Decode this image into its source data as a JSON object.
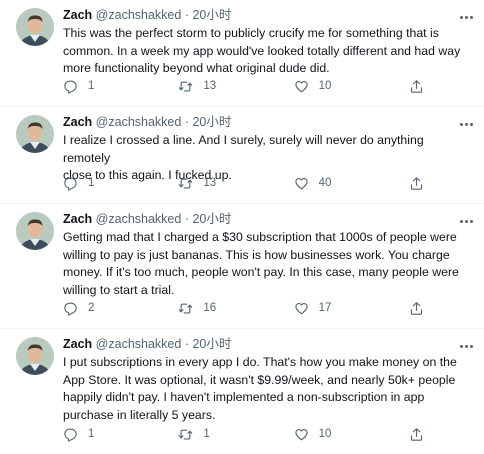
{
  "tweets": [
    {
      "name": "Zach",
      "handle": "@zachshakked",
      "dot": "·",
      "time": "20小时",
      "text": "This was the perfect storm to publicly crucify me for something that is\ncommon. In a week my app would've looked totally different and had way\nmore functionality beyond what original dude did.",
      "replies": "1",
      "retweets": "13",
      "likes": "10"
    },
    {
      "name": "Zach",
      "handle": "@zachshakked",
      "dot": "·",
      "time": "20小时",
      "text": "I realize I crossed a line. And I surely, surely will never do anything remotely\nclose to this again. I fucked up.",
      "replies": "1",
      "retweets": "13",
      "likes": "40"
    },
    {
      "name": "Zach",
      "handle": "@zachshakked",
      "dot": "·",
      "time": "20小时",
      "text": "Getting mad that I charged a $30 subscription that 1000s of people were\nwilling to pay is just bananas. This is how businesses work. You charge\nmoney. If it's too much, people won't pay. In this case, many people were\nwilling to start a trial.",
      "replies": "2",
      "retweets": "16",
      "likes": "17"
    },
    {
      "name": "Zach",
      "handle": "@zachshakked",
      "dot": "·",
      "time": "20小时",
      "text": "I put subscriptions in every app I do. That's how you make money on the\nApp Store. It was optional, it wasn't $9.99/week, and nearly 50k+ people\nhappily didn't pay. I haven't implemented a non-subscription in app\npurchase in literally 5 years.",
      "replies": "1",
      "retweets": "1",
      "likes": "10"
    }
  ],
  "icons": {
    "reply": "reply-icon",
    "retweet": "retweet-icon",
    "like": "heart-icon",
    "share": "share-icon",
    "more": "more-icon"
  },
  "colors": {
    "text": "#0f1419",
    "secondary": "#536471",
    "divider": "#eff3f4"
  }
}
